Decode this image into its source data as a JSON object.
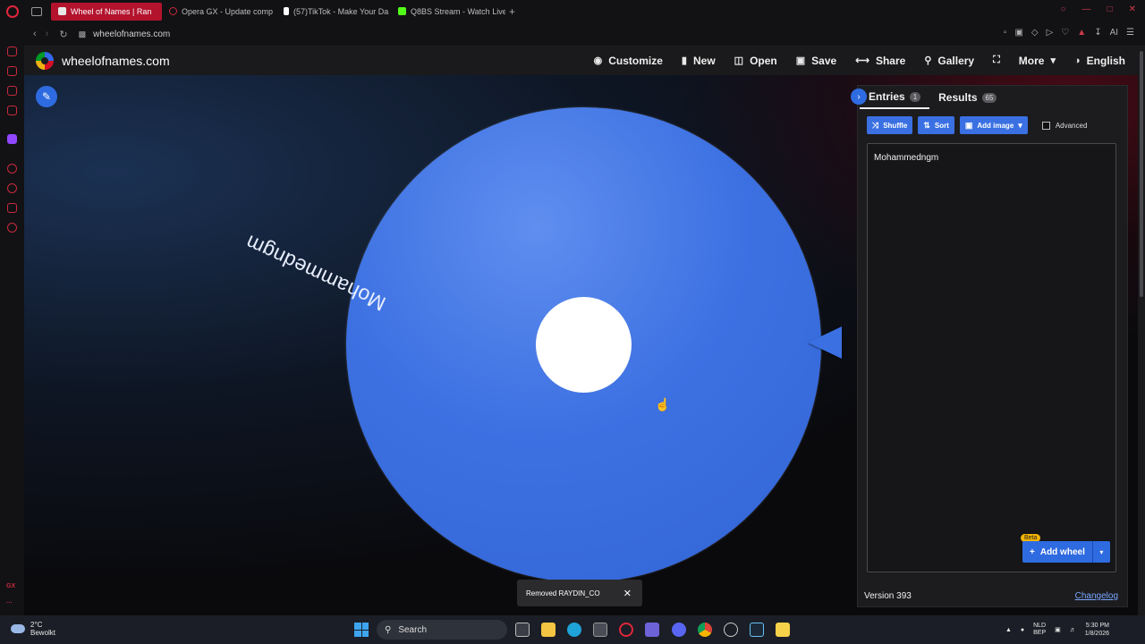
{
  "browser": {
    "tabs": [
      {
        "title": "Wheel of Names | Ran",
        "active": true,
        "favicon_color": "#e8e8e8"
      },
      {
        "title": "Opera GX - Update comp",
        "active": false,
        "favicon_color": "#c8293d"
      },
      {
        "title": "(57)TikTok - Make Your Da",
        "active": false,
        "favicon_color": "#ffffff"
      },
      {
        "title": "Q8BS Stream - Watch Live",
        "active": false,
        "favicon_color": "#53fc18"
      }
    ],
    "new_tab_label": "+",
    "url": "wheelofnames.com",
    "ai_label": "AI"
  },
  "site": {
    "name": "wheelofnames.com",
    "menu": {
      "customize": "Customize",
      "new": "New",
      "open": "Open",
      "save": "Save",
      "share": "Share",
      "gallery": "Gallery",
      "more": "More",
      "language": "English"
    }
  },
  "wheel": {
    "entry_label": "Mohammedngm",
    "segment_color": "#3d71e2"
  },
  "panel": {
    "entries_tab": "Entries",
    "entries_count": "1",
    "results_tab": "Results",
    "results_count": "65",
    "shuffle": "Shuffle",
    "sort": "Sort",
    "add_image": "Add image",
    "advanced": "Advanced",
    "entries_text": "Mohammedngm",
    "beta_badge": "Beta",
    "add_wheel": "Add wheel",
    "version": "Version 393",
    "changelog": "Changelog"
  },
  "toast": {
    "message": "Removed RAYDIN_CO"
  },
  "taskbar": {
    "temperature": "2°C",
    "weather_text": "Bewolkt",
    "search_placeholder": "Search",
    "lang_top": "NLD",
    "lang_bottom": "BEP",
    "time": "5:30 PM",
    "date": "1/8/2026"
  }
}
